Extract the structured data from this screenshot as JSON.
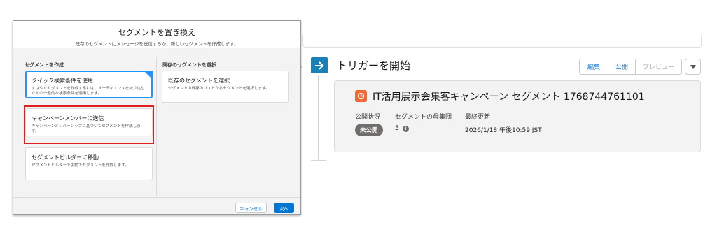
{
  "modal": {
    "title": "セグメントを置き換え",
    "subtitle": "既存のセグメントにメッセージを送信するか、新しいセグメントを作成します。",
    "left_heading": "セグメントを作成",
    "right_heading": "既存のセグメントを選択",
    "options_left": [
      {
        "title": "クイック検索条件を使用",
        "desc": "すばやくセグメントを作成するには、オーディエンスを絞り込むための一般的な検索条件を適用します。",
        "selected": true
      },
      {
        "title": "キャンペーンメンバーに送信",
        "desc": "キャンペーンメンバーシップに基づいてセグメントを作成します。",
        "selected": false
      },
      {
        "title": "セグメントビルダーに移動",
        "desc": "セグメントビルダーで手動でセグメントを作成します。",
        "selected": false
      }
    ],
    "option_right": {
      "title": "既存のセグメントを選択",
      "desc": "セグメントの既存のリストからセグメントを選択します。"
    },
    "cancel_label": "キャンセル",
    "next_label": "次へ"
  },
  "page": {
    "trigger_title": "トリガーを開始",
    "buttons": [
      "編集",
      "公開",
      "プレビュー"
    ],
    "segment": {
      "name": "IT活用展示会集客キャンペーン セグメント 1768744761101",
      "status_label": "公開状況",
      "status_value": "未公開",
      "population_label": "セグメントの母集団",
      "population_value": "5",
      "updated_label": "最終更新",
      "updated_value": "2026/1/18 午後10:59 JST"
    }
  },
  "colors": {
    "accent": "#0176d3",
    "highlight": "#e02020",
    "trigger": "#1b7fb8",
    "segment_icon": "#f26837"
  }
}
